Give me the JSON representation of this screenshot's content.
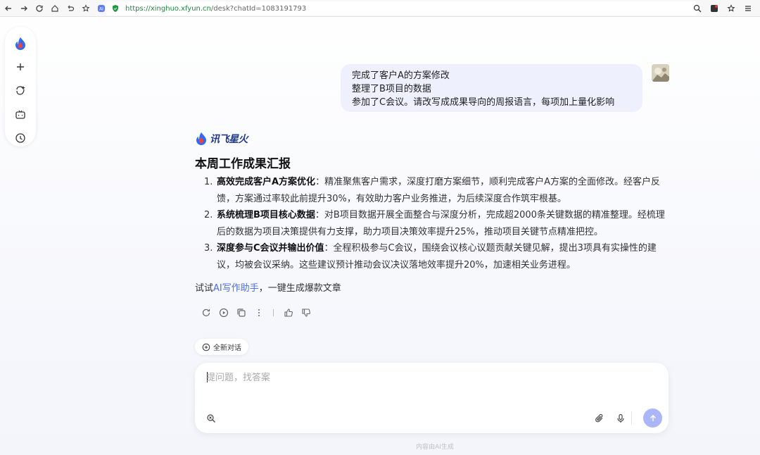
{
  "browser": {
    "url_host": "https://xinghuo.xfyun.cn",
    "url_path": "/desk?chatId=1083191793"
  },
  "sidebar": {
    "items": [
      "logo-icon",
      "new-icon",
      "agent-icon",
      "bot-icon",
      "history-icon"
    ]
  },
  "user_message": {
    "lines": [
      "完成了客户A的方案修改",
      "整理了B项目的数据",
      "参加了C会议。请改写成成果导向的周报语言，每项加上量化影响"
    ]
  },
  "brand": {
    "name": "讯飞星火"
  },
  "answer": {
    "title": "本周工作成果汇报",
    "items": [
      {
        "num": "1.",
        "head": "高效完成客户A方案优化",
        "text": "：精准聚焦客户需求，深度打磨方案细节，顺利完成客户A方案的全面修改。经客户反馈，方案通过率较此前提升30%，有效助力客户业务推进，为后续深度合作筑牢根基。"
      },
      {
        "num": "2.",
        "head": "系统梳理B项目核心数据",
        "text": "：对B项目数据开展全面整合与深度分析，完成超2000条关键数据的精准整理。经梳理后的数据为项目决策提供有力支撑，助力项目决策效率提升25%，推动项目关键节点精准把控。"
      },
      {
        "num": "3.",
        "head": "深度参与C会议并输出价值",
        "text": "：全程积极参与C会议，围绕会议核心议题贡献关键见解，提出3项具有实操性的建议，均被会议采纳。这些建议预计推动会议决议落地效率提升20%，加速相关业务进程。"
      }
    ],
    "try_prefix": "试试",
    "try_link": "AI写作助手",
    "try_suffix": "，一键生成爆款文章"
  },
  "new_chat_label": "全新对话",
  "input": {
    "placeholder": "提问题，找答案"
  },
  "footnote": "内容由AI生成"
}
